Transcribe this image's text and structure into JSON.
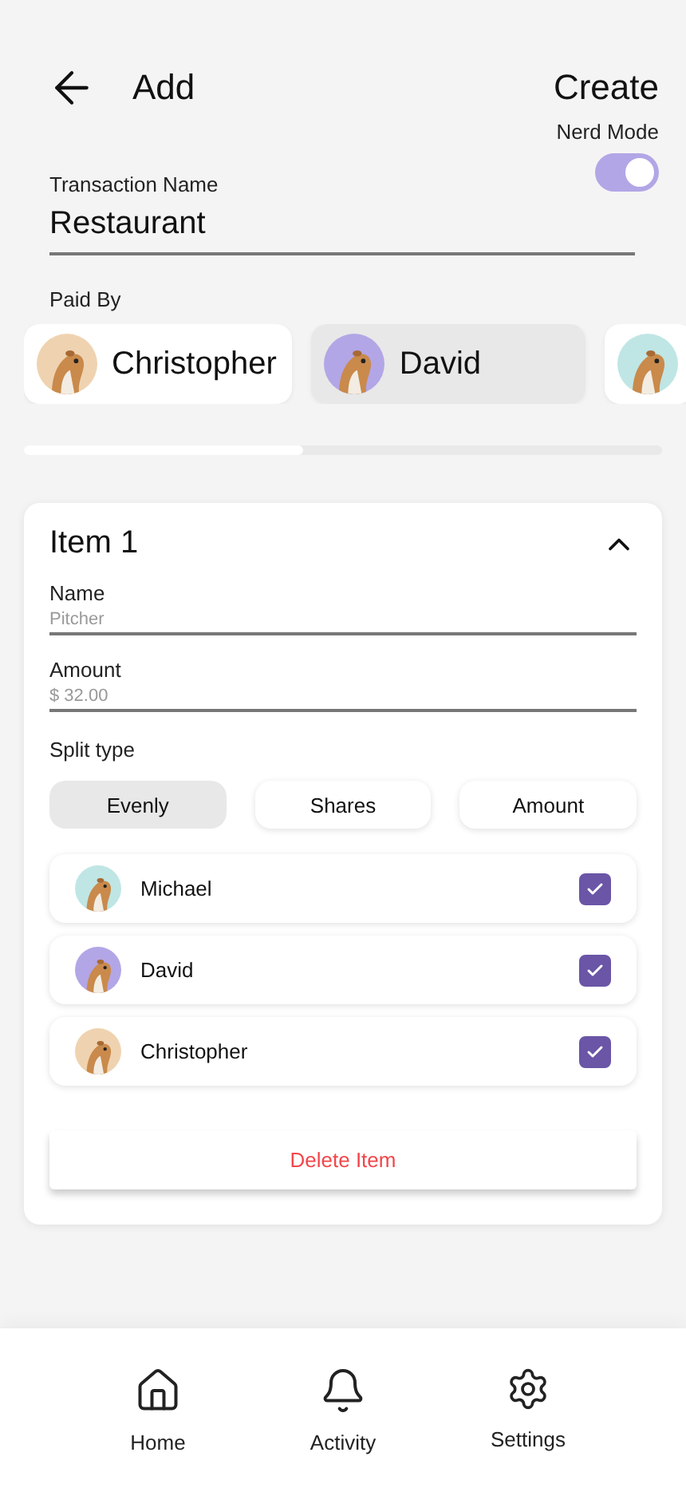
{
  "header": {
    "title": "Add",
    "action": "Create"
  },
  "nerd_mode": {
    "label": "Nerd Mode",
    "on": true
  },
  "transaction_name": {
    "label": "Transaction Name",
    "value": "Restaurant"
  },
  "paid_by": {
    "label": "Paid By",
    "people": [
      {
        "name": "Christopher",
        "selected": false,
        "color": "#efd3b0"
      },
      {
        "name": "David",
        "selected": true,
        "color": "#b3a6e6"
      },
      {
        "selected": false,
        "color": "#bfe6e4"
      }
    ]
  },
  "items": [
    {
      "title": "Item 1",
      "expanded": true,
      "name": {
        "label": "Name",
        "placeholder": "Pitcher"
      },
      "amount": {
        "label": "Amount",
        "placeholder": "$ 32.00"
      },
      "split_type": {
        "label": "Split type",
        "options": [
          {
            "label": "Evenly",
            "selected": true
          },
          {
            "label": "Shares",
            "selected": false
          },
          {
            "label": "Amount",
            "selected": false
          }
        ]
      },
      "members": [
        {
          "name": "Michael",
          "checked": true,
          "color": "#bfe6e4"
        },
        {
          "name": "David",
          "checked": true,
          "color": "#b3a6e6"
        },
        {
          "name": "Christopher",
          "checked": true,
          "color": "#efd3b0"
        }
      ],
      "delete": "Delete Item"
    }
  ],
  "nav": [
    {
      "label": "Home",
      "kind": "home"
    },
    {
      "label": "Activity",
      "kind": "activity"
    },
    {
      "label": "Settings",
      "kind": "settings"
    }
  ]
}
